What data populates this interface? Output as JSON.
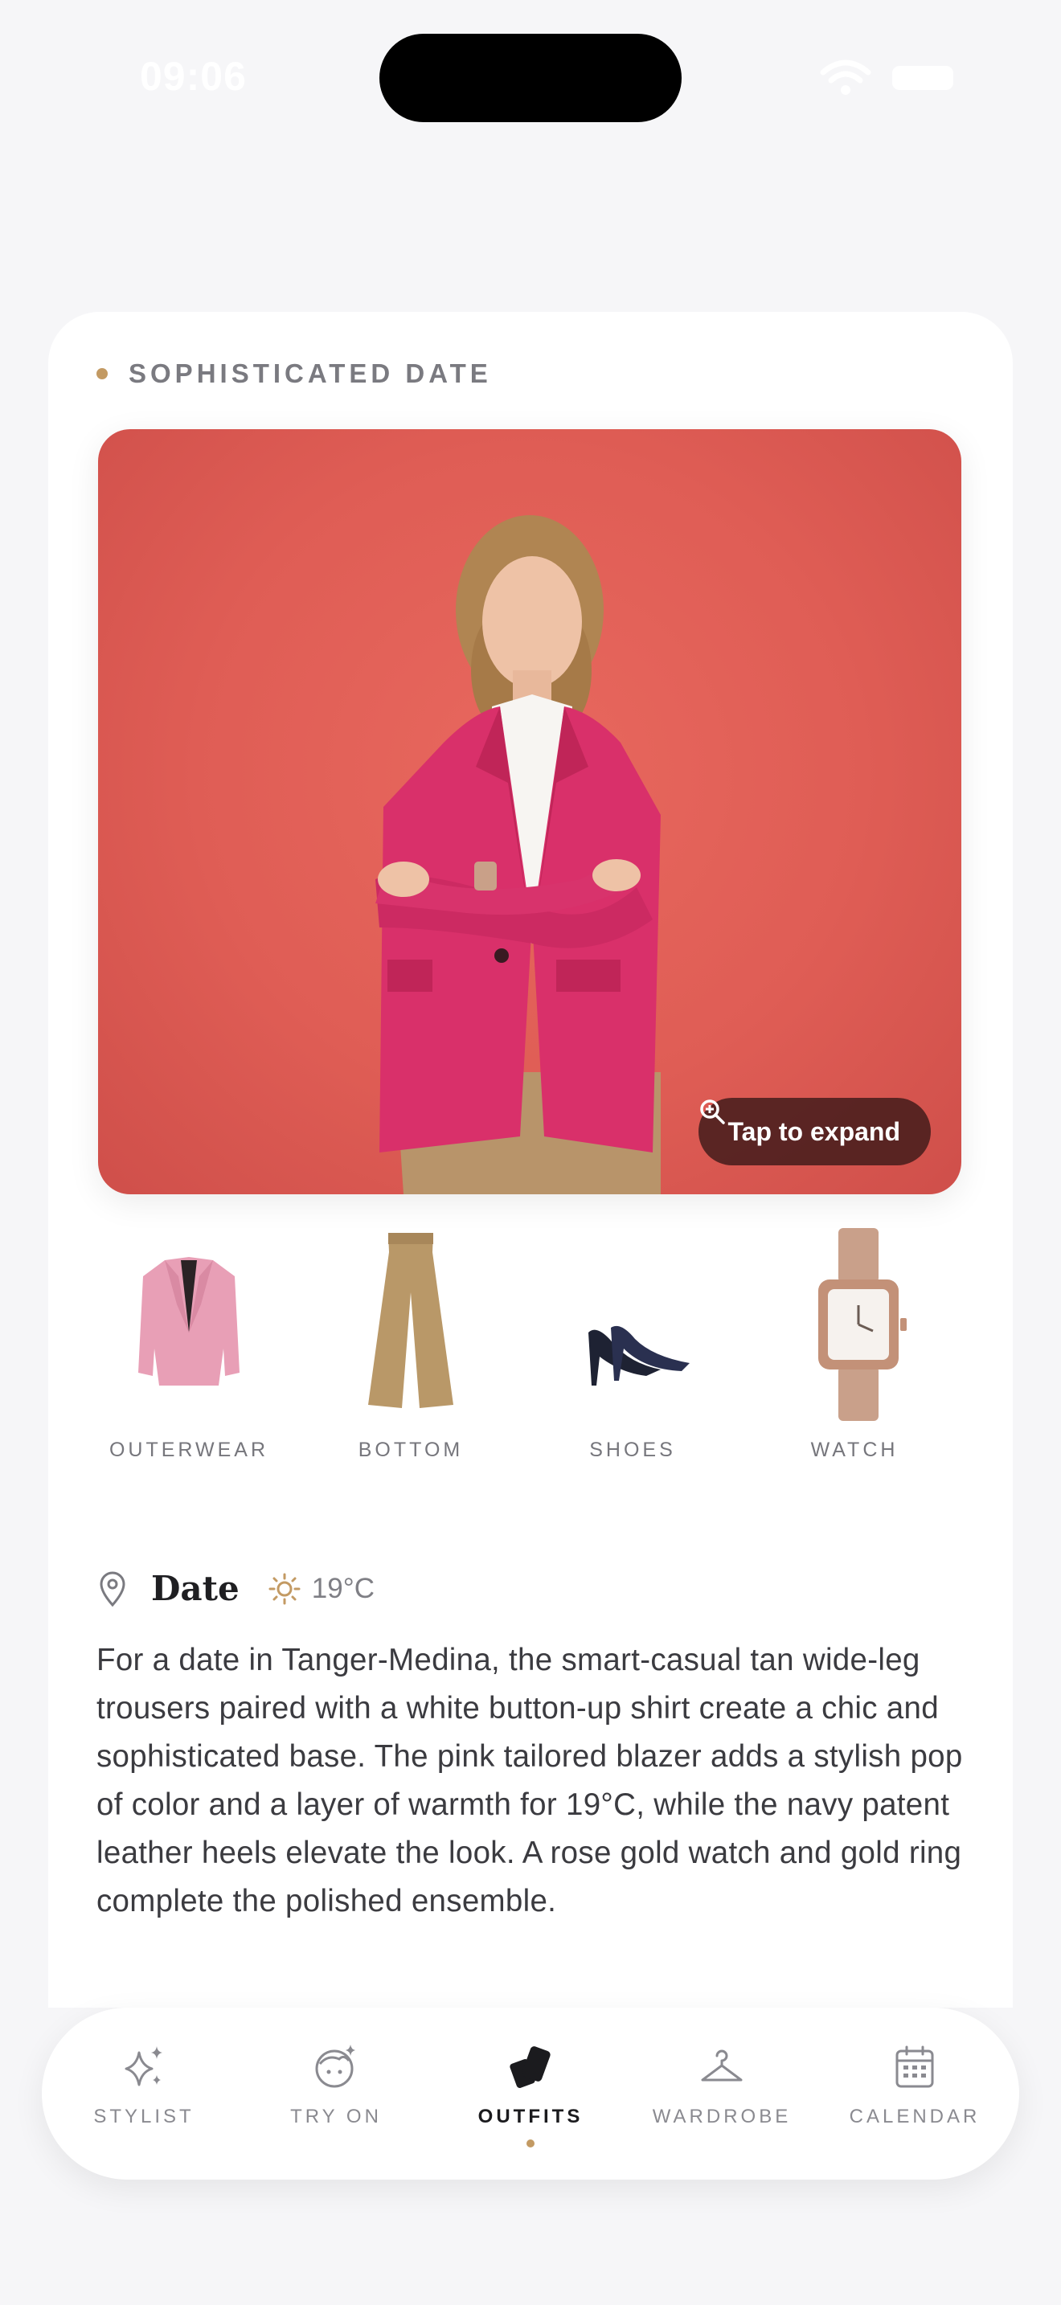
{
  "status": {
    "time": "09:06"
  },
  "card": {
    "title": "SOPHISTICATED DATE",
    "expand_label": "Tap to expand",
    "items": [
      {
        "label": "OUTERWEAR",
        "icon": "pink-blazer-icon"
      },
      {
        "label": "BOTTOM",
        "icon": "tan-trousers-icon"
      },
      {
        "label": "SHOES",
        "icon": "navy-heels-icon"
      },
      {
        "label": "WATCH",
        "icon": "rose-gold-watch-icon"
      }
    ],
    "occasion": "Date",
    "temperature": "19°C",
    "description": "For a date in Tanger-Medina, the smart-casual tan wide-leg trousers paired with a white button-up shirt create a chic and sophisticated base. The pink tailored blazer adds a stylish pop of color and a layer of warmth for 19°C, while the navy patent leather heels elevate the look. A rose gold watch and gold ring complete the polished ensemble."
  },
  "tabs": [
    {
      "label": "STYLIST",
      "icon": "sparkles-icon",
      "active": false
    },
    {
      "label": "TRY ON",
      "icon": "face-sparkle-icon",
      "active": false
    },
    {
      "label": "OUTFITS",
      "icon": "cards-icon",
      "active": true
    },
    {
      "label": "WARDROBE",
      "icon": "hanger-icon",
      "active": false
    },
    {
      "label": "CALENDAR",
      "icon": "calendar-icon",
      "active": false
    }
  ],
  "colors": {
    "accent": "#c39a63",
    "hero_background": "#df5d55",
    "blazer": "#d9306a"
  }
}
